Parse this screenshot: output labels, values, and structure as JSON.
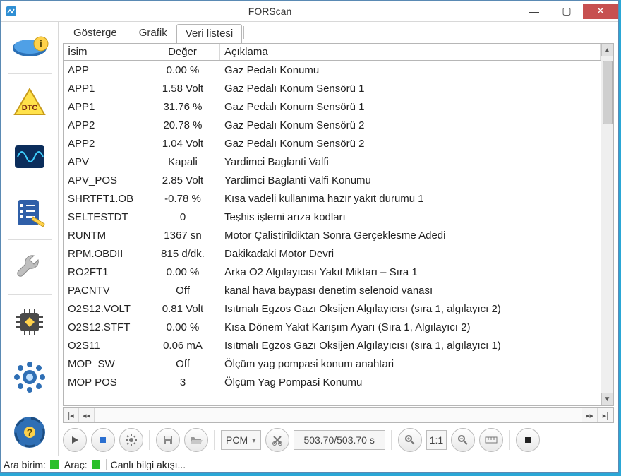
{
  "window": {
    "title": "FORScan"
  },
  "tabs": [
    {
      "label": "Gösterge",
      "active": false
    },
    {
      "label": "Grafik",
      "active": false
    },
    {
      "label": "Veri listesi",
      "active": true
    }
  ],
  "columns": {
    "name": "İsim",
    "value": "Değer",
    "desc": "Açıklama"
  },
  "rows": [
    {
      "name": "APP",
      "value": "0.00 %",
      "desc": "Gaz Pedalı Konumu"
    },
    {
      "name": "APP1",
      "value": "1.58 Volt",
      "desc": "Gaz Pedalı Konum Sensörü 1"
    },
    {
      "name": "APP1",
      "value": "31.76 %",
      "desc": "Gaz Pedalı Konum Sensörü 1"
    },
    {
      "name": "APP2",
      "value": "20.78 %",
      "desc": "Gaz Pedalı Konum Sensörü 2"
    },
    {
      "name": "APP2",
      "value": "1.04 Volt",
      "desc": "Gaz Pedalı Konum Sensörü 2"
    },
    {
      "name": "APV",
      "value": "Kapali",
      "desc": "Yardimci Baglanti Valfi"
    },
    {
      "name": "APV_POS",
      "value": "2.85 Volt",
      "desc": "Yardimci Baglanti Valfi Konumu"
    },
    {
      "name": "SHRTFT1.OB",
      "value": "-0.78 %",
      "desc": "Kısa vadeli kullanıma hazır yakıt durumu 1"
    },
    {
      "name": "SELTESTDT",
      "value": "0",
      "desc": "Teşhis işlemi arıza kodları"
    },
    {
      "name": "RUNTM",
      "value": "1367 sn",
      "desc": "Motor Çalistirildiktan Sonra Gerçeklesme Adedi"
    },
    {
      "name": "RPM.OBDII",
      "value": "815 d/dk.",
      "desc": "Dakikadaki Motor Devri"
    },
    {
      "name": "RO2FT1",
      "value": "0.00 %",
      "desc": "Arka O2 Algılayıcısı Yakıt Miktarı – Sıra 1"
    },
    {
      "name": "PACNTV",
      "value": "Off",
      "desc": "kanal hava baypası denetim selenoid vanası"
    },
    {
      "name": "O2S12.VOLT",
      "value": "0.81 Volt",
      "desc": "Isıtmalı Egzos Gazı Oksijen Algılayıcısı (sıra 1, algılayıcı 2)"
    },
    {
      "name": "O2S12.STFT",
      "value": "0.00 %",
      "desc": "Kısa Dönem Yakıt Karışım Ayarı (Sıra 1, Algılayıcı 2)"
    },
    {
      "name": "O2S11",
      "value": "0.06 mA",
      "desc": "Isıtmalı Egzos Gazı Oksijen Algılayıcısı (sıra 1, algılayıcı 1)"
    },
    {
      "name": "MOP_SW",
      "value": "Off",
      "desc": "Ölçüm yag pompasi konum anahtari"
    },
    {
      "name": "MOP POS",
      "value": "3",
      "desc": "Ölçüm Yag Pompasi Konumu"
    }
  ],
  "toolbar": {
    "module": "PCM",
    "time": "503.70/503.70 s",
    "zoom": "1:1"
  },
  "status": {
    "label_search_unit": "Ara birim:",
    "label_vehicle": "Araç:",
    "live": "Canlı bilgi akışı..."
  }
}
